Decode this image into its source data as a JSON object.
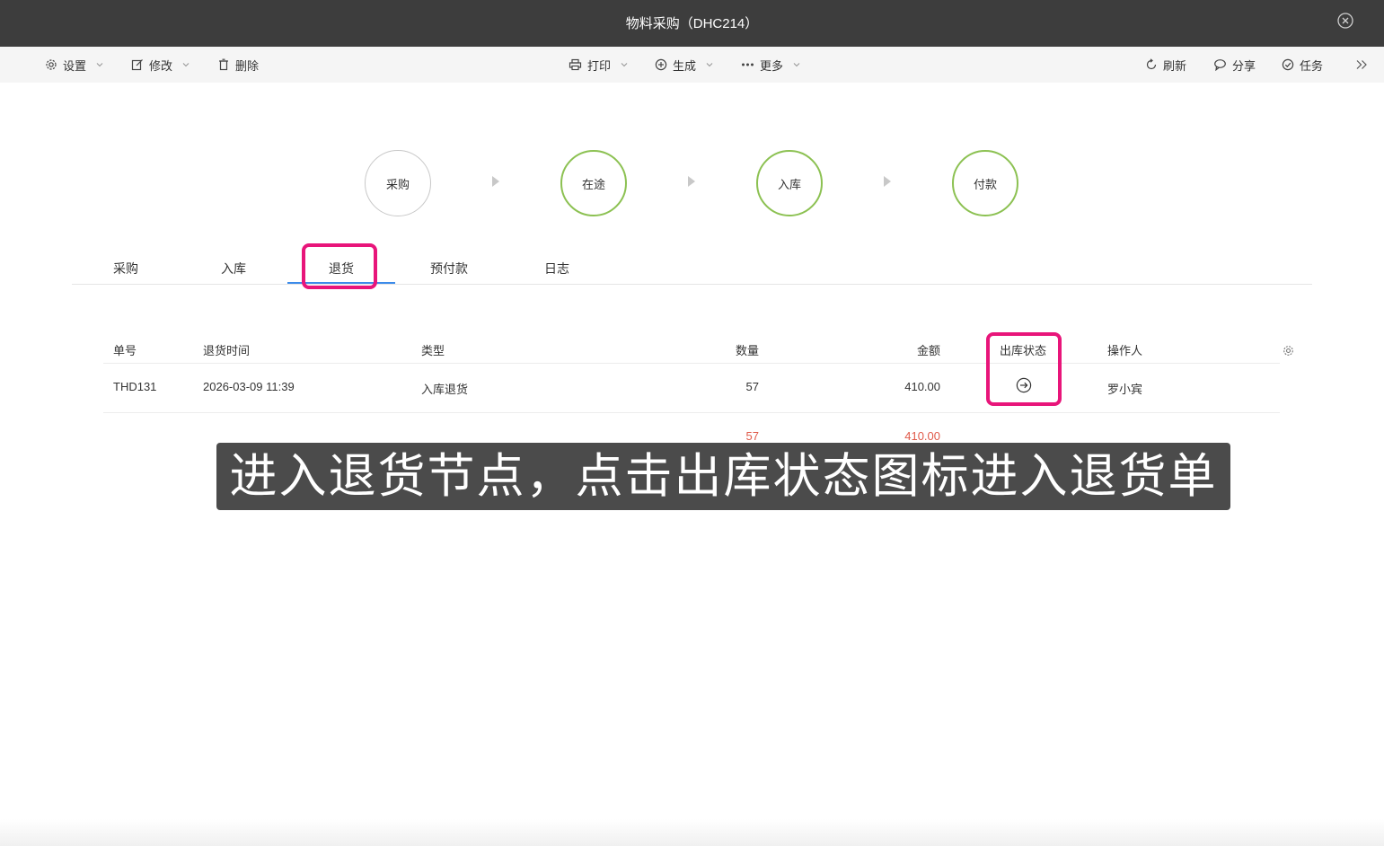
{
  "window": {
    "title": "物料采购（DHC214）"
  },
  "toolbar": {
    "left": [
      {
        "label": "设置",
        "icon": "gear-icon",
        "dropdown": true
      },
      {
        "label": "修改",
        "icon": "edit-icon",
        "dropdown": true
      },
      {
        "label": "删除",
        "icon": "trash-icon",
        "dropdown": false
      }
    ],
    "center": [
      {
        "label": "打印",
        "icon": "printer-icon",
        "dropdown": true
      },
      {
        "label": "生成",
        "icon": "plus-circle-icon",
        "dropdown": true
      },
      {
        "label": "更多",
        "icon": "more-icon",
        "dropdown": true
      }
    ],
    "right": [
      {
        "label": "刷新",
        "icon": "refresh-icon"
      },
      {
        "label": "分享",
        "icon": "chat-icon"
      },
      {
        "label": "任务",
        "icon": "check-circle-icon"
      }
    ]
  },
  "flow": [
    {
      "label": "采购",
      "state": "pending"
    },
    {
      "label": "在途",
      "state": "done"
    },
    {
      "label": "入库",
      "state": "done"
    },
    {
      "label": "付款",
      "state": "done"
    }
  ],
  "tabs": [
    {
      "label": "采购",
      "active": false
    },
    {
      "label": "入库",
      "active": false
    },
    {
      "label": "退货",
      "active": true
    },
    {
      "label": "预付款",
      "active": false
    },
    {
      "label": "日志",
      "active": false
    }
  ],
  "table": {
    "headers": {
      "no": "单号",
      "time": "退货时间",
      "type": "类型",
      "qty": "数量",
      "amount": "金额",
      "status": "出库状态",
      "operator": "操作人"
    },
    "rows": [
      {
        "no": "THD131",
        "time": "2026-03-09 11:39",
        "type": "入库退货",
        "qty": "57",
        "amount": "410.00",
        "status_icon": "arrow-right-circle-icon",
        "operator": "罗小宾"
      }
    ],
    "summary": {
      "qty": "57",
      "amount": "410.00"
    }
  },
  "caption": "进入退货节点，点击出库状态图标进入退货单",
  "colors": {
    "highlight": "#e8157a",
    "flow_done": "#8cc152",
    "tab_active": "#3b8bea",
    "summary": "#e05a4a"
  }
}
